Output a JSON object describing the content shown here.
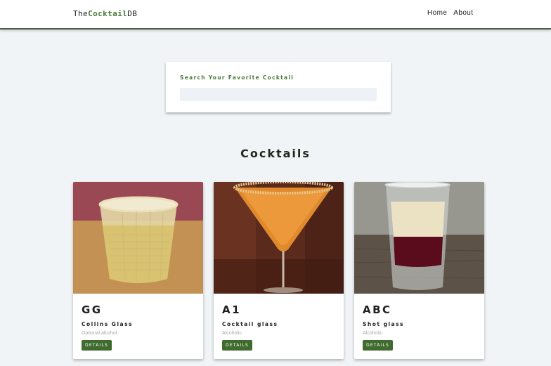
{
  "navbar": {
    "logo_prefix": "The",
    "logo_accent": "Cocktail",
    "logo_suffix": "DB",
    "links": [
      "Home",
      "About"
    ]
  },
  "search": {
    "label": "Search Your Favorite Cocktail",
    "value": ""
  },
  "section_title": "Cocktails",
  "cocktails": [
    {
      "name": "GG",
      "glass": "Collins Glass",
      "info": "Optional alcohol",
      "button": "DETAILS"
    },
    {
      "name": "A1",
      "glass": "Cocktail glass",
      "info": "Alcoholic",
      "button": "DETAILS"
    },
    {
      "name": "ABC",
      "glass": "Shot glass",
      "info": "Alcoholic",
      "button": "DETAILS"
    }
  ],
  "colors": {
    "accent": "#4a7a3a",
    "button": "#3f6b2e",
    "background": "#f0f4f7"
  }
}
